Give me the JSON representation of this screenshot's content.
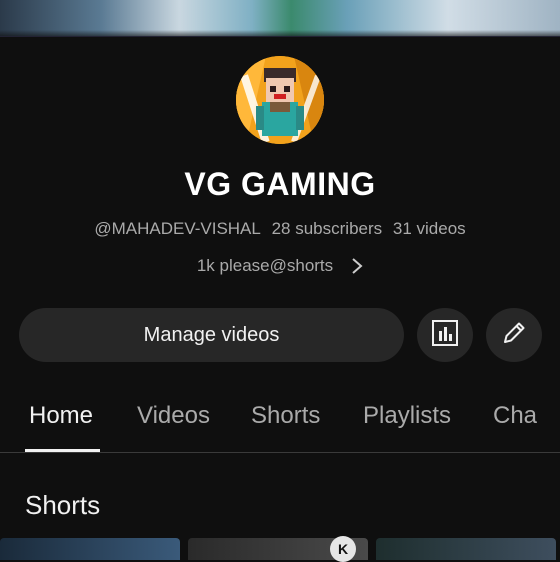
{
  "channel": {
    "name": "VG GAMING",
    "handle": "@MAHADEV-VISHAL",
    "subscribers": "28 subscribers",
    "videos": "31 videos",
    "description": "1k please@shorts"
  },
  "actions": {
    "manage_videos_label": "Manage videos",
    "analytics_icon": "bar-chart-icon",
    "edit_icon": "pencil-icon"
  },
  "tabs": [
    {
      "label": "Home",
      "active": true
    },
    {
      "label": "Videos",
      "active": false
    },
    {
      "label": "Shorts",
      "active": false
    },
    {
      "label": "Playlists",
      "active": false
    },
    {
      "label": "Cha",
      "active": false
    }
  ],
  "sections": {
    "shorts_title": "Shorts"
  },
  "watermark": "K",
  "colors": {
    "background": "#0f0f0f",
    "button_bg": "#272727",
    "text_primary": "#f1f1f1",
    "text_secondary": "#aaaaaa",
    "avatar_bg": "#f2a21c"
  }
}
